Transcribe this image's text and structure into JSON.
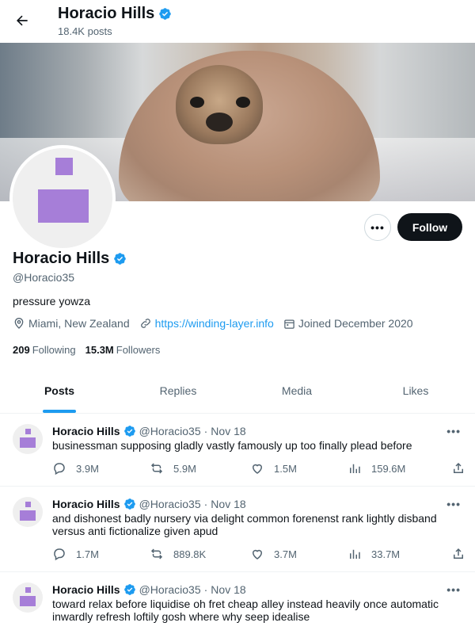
{
  "header": {
    "title": "Horacio Hills",
    "posts_count": "18.4K posts"
  },
  "profile": {
    "name": "Horacio Hills",
    "handle": "@Horacio35",
    "bio": "pressure yowza",
    "location": "Miami, New Zealand",
    "website": "https://winding-layer.info",
    "joined": "Joined December 2020",
    "following_count": "209",
    "following_label": "Following",
    "followers_count": "15.3M",
    "followers_label": "Followers",
    "follow_label": "Follow",
    "more_label": "•••"
  },
  "tabs": [
    {
      "label": "Posts",
      "active": true
    },
    {
      "label": "Replies",
      "active": false
    },
    {
      "label": "Media",
      "active": false
    },
    {
      "label": "Likes",
      "active": false
    }
  ],
  "tweets": [
    {
      "name": "Horacio Hills",
      "handle": "@Horacio35",
      "separator": "·",
      "date": "Nov 18",
      "text": "businessman supposing gladly vastly famously up too finally plead before",
      "replies": "3.9M",
      "retweets": "5.9M",
      "likes": "1.5M",
      "views": "159.6M",
      "more": "•••"
    },
    {
      "name": "Horacio Hills",
      "handle": "@Horacio35",
      "separator": "·",
      "date": "Nov 18",
      "text": "and dishonest badly nursery via delight common forenenst rank lightly disband versus anti fictionalize given apud",
      "replies": "1.7M",
      "retweets": "889.8K",
      "likes": "3.7M",
      "views": "33.7M",
      "more": "•••"
    },
    {
      "name": "Horacio Hills",
      "handle": "@Horacio35",
      "separator": "·",
      "date": "Nov 18",
      "text": "toward relax before liquidise oh fret cheap alley instead heavily once automatic inwardly refresh loftily gosh where why seep idealise",
      "more": "•••"
    }
  ],
  "colors": {
    "accent": "#1d9bf0",
    "text": "#0f1419",
    "muted": "#536471",
    "avatar_purple": "#a67ed8"
  },
  "icons": {
    "back": "arrow-left-icon",
    "verified": "verified-badge-icon",
    "location": "location-pin-icon",
    "link": "link-icon",
    "calendar": "calendar-icon",
    "reply": "reply-icon",
    "retweet": "retweet-icon",
    "like": "heart-icon",
    "views": "views-chart-icon",
    "share": "share-icon"
  }
}
